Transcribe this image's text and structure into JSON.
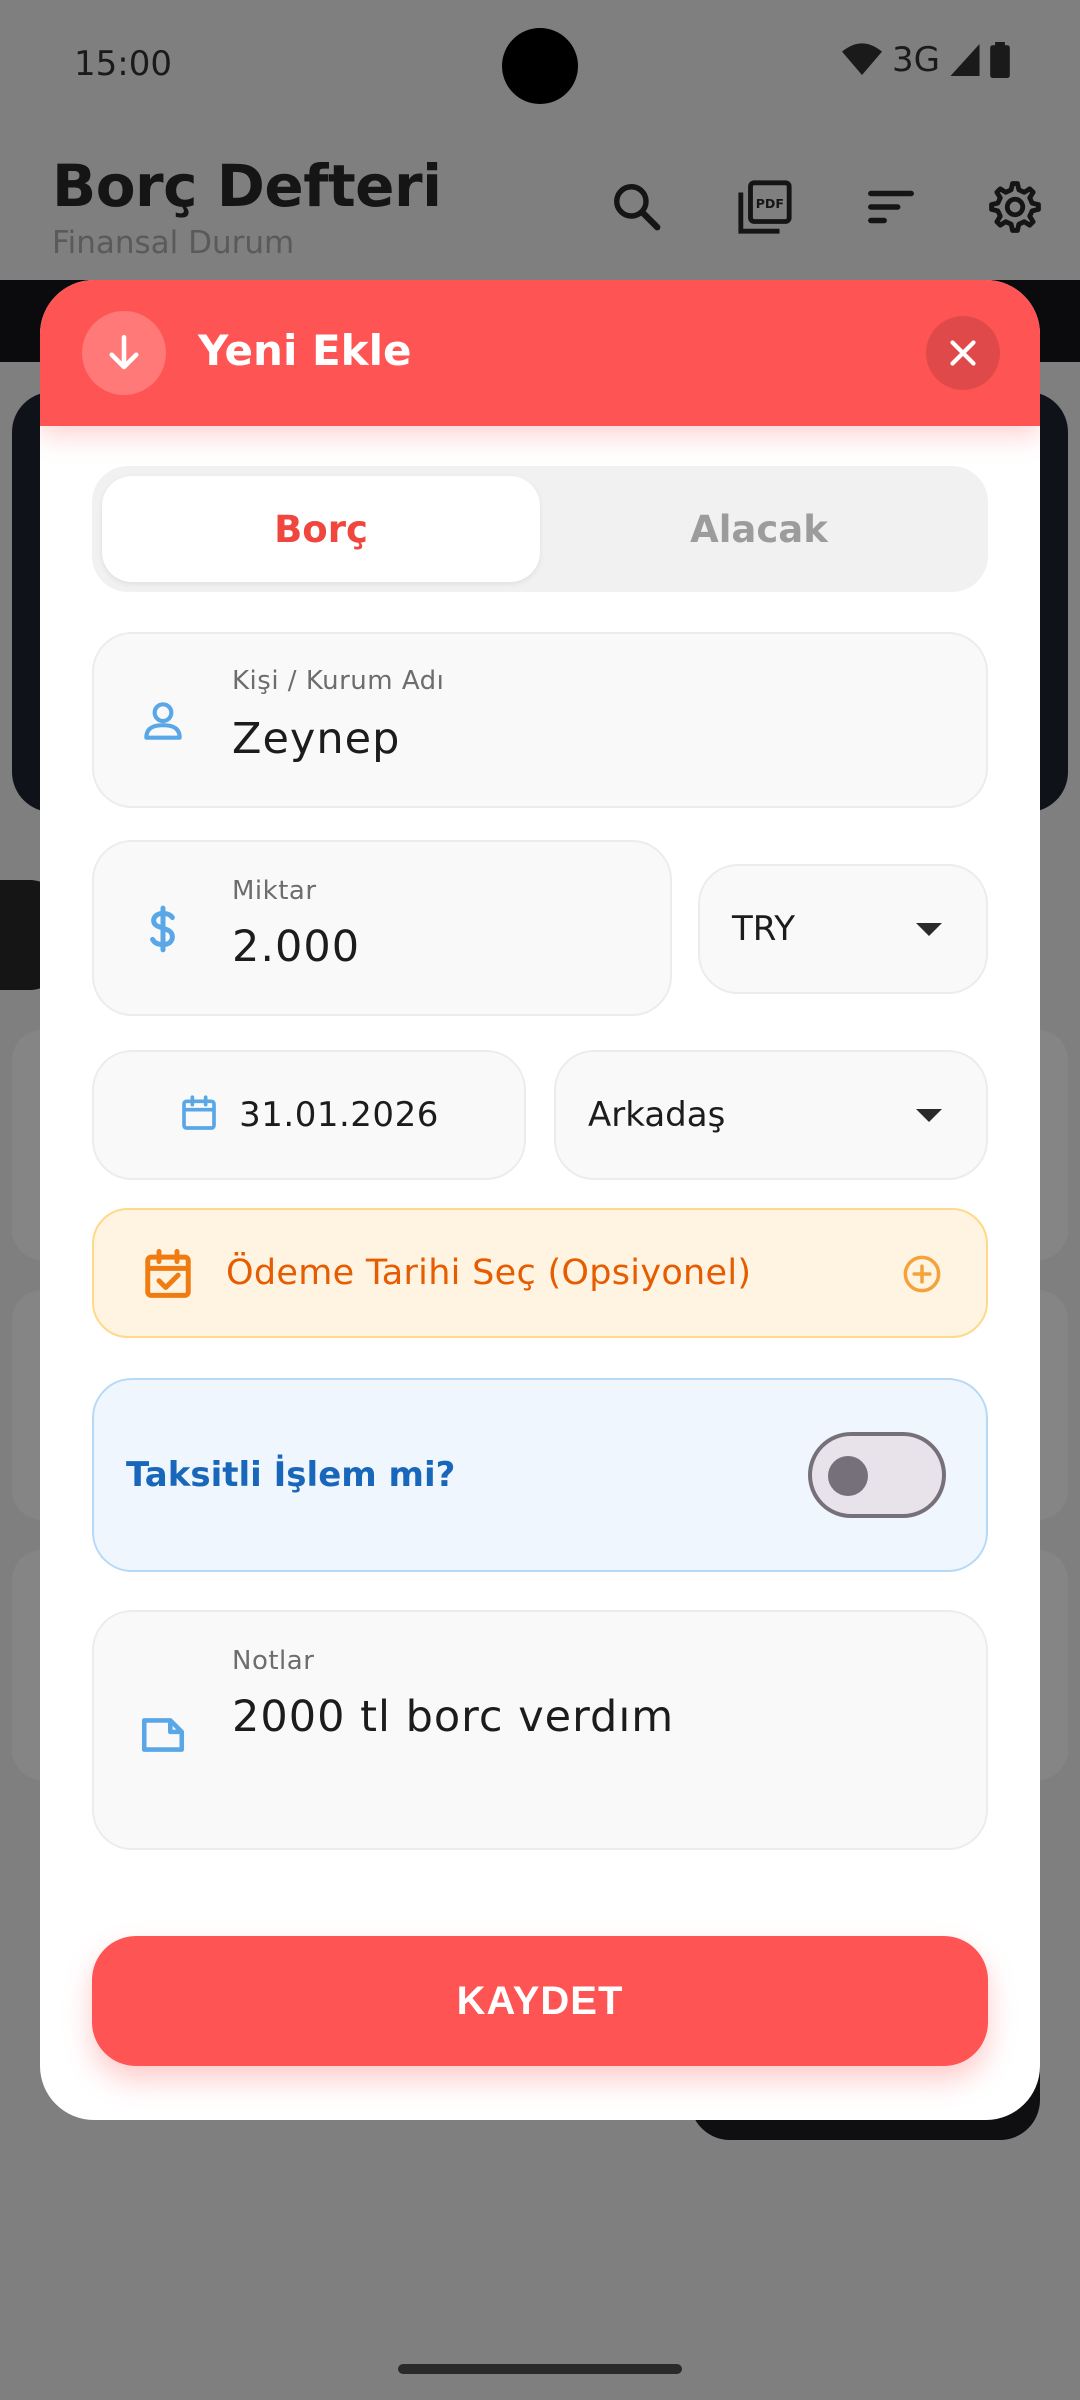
{
  "status_bar": {
    "time": "15:00",
    "network": "3G"
  },
  "app": {
    "title": "Borç Defteri",
    "subtitle": "Finansal Durum"
  },
  "dialog": {
    "title": "Yeni Ekle",
    "tabs": [
      {
        "label": "Borç",
        "active": true
      },
      {
        "label": "Alacak",
        "active": false
      }
    ],
    "name_field": {
      "label": "Kişi / Kurum Adı",
      "value": "Zeynep"
    },
    "amount_field": {
      "label": "Miktar",
      "value": "2.000"
    },
    "currency": {
      "selected": "TRY"
    },
    "date": {
      "value": "31.01.2026"
    },
    "category": {
      "selected": "Arkadaş"
    },
    "payment_date": {
      "label": "Ödeme Tarihi Seç (Opsiyonel)"
    },
    "installment": {
      "label": "Taksitli İşlem mi?",
      "enabled": false
    },
    "notes_field": {
      "label": "Notlar",
      "value": "2000 tl borc verdım"
    },
    "save_label": "KAYDET"
  },
  "colors": {
    "accent": "#ff5454",
    "active_tab_text": "#f0463e",
    "payment_date_text": "#e65c00",
    "installment_text": "#1867bb",
    "field_icon": "#5aa7e8"
  },
  "icons": {
    "header": [
      "search-icon",
      "pdf-icon",
      "sort-icon",
      "gear-icon"
    ],
    "dialog": [
      "arrow-down-icon",
      "close-icon",
      "person-icon",
      "dollar-icon",
      "calendar-icon",
      "calendar-check-icon",
      "plus-circle-icon",
      "note-icon"
    ]
  }
}
